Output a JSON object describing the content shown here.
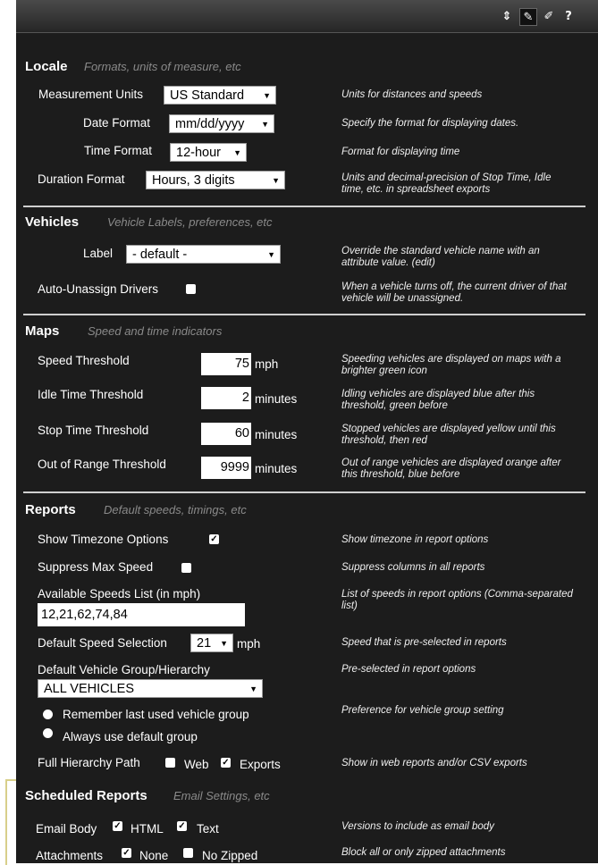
{
  "toolbar": {
    "icons": [
      "sort-icon",
      "wrench-icon",
      "pencil-icon",
      "help-icon"
    ]
  },
  "locale": {
    "title": "Locale",
    "subtitle": "Formats, units of measure, etc",
    "measurement_units": {
      "label": "Measurement Units",
      "value": "US Standard",
      "help": "Units for distances and speeds"
    },
    "date_format": {
      "label": "Date Format",
      "value": "mm/dd/yyyy",
      "help": "Specify the format for displaying dates."
    },
    "time_format": {
      "label": "Time Format",
      "value": "12-hour",
      "help": "Format for displaying time"
    },
    "duration_format": {
      "label": "Duration Format",
      "value": "Hours, 3 digits",
      "help": "Units and decimal-precision of Stop Time, Idle time, etc. in spreadsheet exports"
    }
  },
  "vehicles": {
    "title": "Vehicles",
    "subtitle": "Vehicle Labels, preferences, etc",
    "label": {
      "label": "Label",
      "value": "- default -",
      "help": "Override the standard vehicle name with an attribute value. (edit)"
    },
    "auto_unassign": {
      "label": "Auto-Unassign Drivers",
      "checked": false,
      "help": "When a vehicle turns off, the current driver of that vehicle will be unassigned."
    }
  },
  "maps": {
    "title": "Maps",
    "subtitle": "Speed and time indicators",
    "speed_threshold": {
      "label": "Speed Threshold",
      "value": "75",
      "unit": "mph",
      "help": "Speeding vehicles are displayed on maps with a brighter green icon"
    },
    "idle_threshold": {
      "label": "Idle Time Threshold",
      "value": "2",
      "unit": "minutes",
      "help": "Idling vehicles are displayed blue after this threshold, green before"
    },
    "stop_threshold": {
      "label": "Stop Time Threshold",
      "value": "60",
      "unit": "minutes",
      "help": "Stopped vehicles are displayed yellow until this threshold, then red"
    },
    "range_threshold": {
      "label": "Out of Range Threshold",
      "value": "9999",
      "unit": "minutes",
      "help": "Out of range vehicles are displayed orange after this threshold, blue before"
    }
  },
  "reports": {
    "title": "Reports",
    "subtitle": "Default speeds, timings, etc",
    "timezone": {
      "label": "Show Timezone Options",
      "checked": true,
      "help": "Show timezone in report options"
    },
    "suppress": {
      "label": "Suppress Max Speed",
      "checked": false,
      "help": "Suppress columns in all reports"
    },
    "speeds_list": {
      "label": "Available Speeds List (in mph)",
      "value": "12,21,62,74,84",
      "help": "List of speeds in report options (Comma-separated list)"
    },
    "default_speed": {
      "label": "Default Speed Selection",
      "value": "21",
      "unit": "mph",
      "help": "Speed that is pre-selected in reports"
    },
    "vehicle_group": {
      "label": "Default Vehicle Group/Hierarchy",
      "value": "ALL VEHICLES",
      "help": "Pre-selected in report options"
    },
    "group_pref": {
      "option_remember": "Remember last used vehicle group",
      "option_default": "Always use default group",
      "help": "Preference for vehicle group setting"
    },
    "hierarchy": {
      "label": "Full Hierarchy Path",
      "web_label": "Web",
      "web_checked": false,
      "exports_label": "Exports",
      "exports_checked": true,
      "help": "Show in web reports and/or CSV exports"
    }
  },
  "scheduled": {
    "title": "Scheduled Reports",
    "subtitle": "Email Settings, etc",
    "email_body": {
      "label": "Email Body",
      "html_label": "HTML",
      "html_checked": true,
      "text_label": "Text",
      "text_checked": true,
      "help": "Versions to include as email body"
    },
    "attachments": {
      "label": "Attachments",
      "none_label": "None",
      "none_checked": true,
      "nozip_label": "No Zipped",
      "nozip_checked": false,
      "help": "Block all or only zipped attachments"
    }
  }
}
